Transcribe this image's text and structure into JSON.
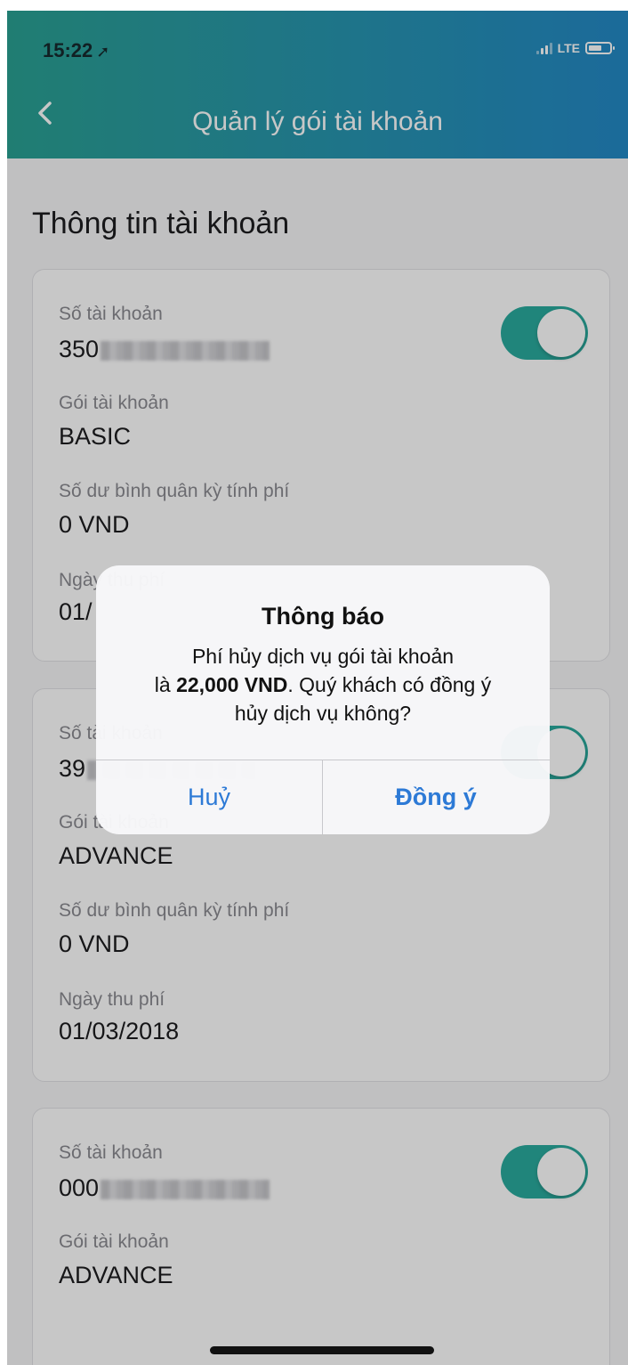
{
  "status_bar": {
    "time": "15:22",
    "network": "LTE"
  },
  "header": {
    "title": "Quản lý gói tài khoản"
  },
  "section_title": "Thông tin tài khoản",
  "accounts": [
    {
      "account_label": "Số tài khoản",
      "account_prefix": "350",
      "account_on": true,
      "package_label": "Gói tài khoản",
      "package_value": "BASIC",
      "balance_label": "Số dư bình quân kỳ tính phí",
      "balance_value": "0 VND",
      "fee_date_label": "Ngày thu phí",
      "fee_date_partial": "01/"
    },
    {
      "account_label": "Số tài khoản",
      "account_prefix": "39",
      "account_on": true,
      "package_label": "Gói tài khoản",
      "package_value": "ADVANCE",
      "balance_label": "Số dư bình quân kỳ tính phí",
      "balance_value": "0 VND",
      "fee_date_label": "Ngày thu phí",
      "fee_date_value": "01/03/2018"
    },
    {
      "account_label": "Số tài khoản",
      "account_prefix": "000",
      "account_on": true,
      "package_label": "Gói tài khoản",
      "package_value": "ADVANCE"
    }
  ],
  "alert": {
    "title": "Thông báo",
    "message_line1": "Phí hủy dịch vụ gói tài khoản",
    "message_prefix": "là ",
    "message_amount": "22,000 VND",
    "message_suffix": ". Quý khách có đồng ý",
    "message_line3": "hủy dịch vụ không?",
    "cancel_label": "Huỷ",
    "confirm_label": "Đồng ý"
  }
}
